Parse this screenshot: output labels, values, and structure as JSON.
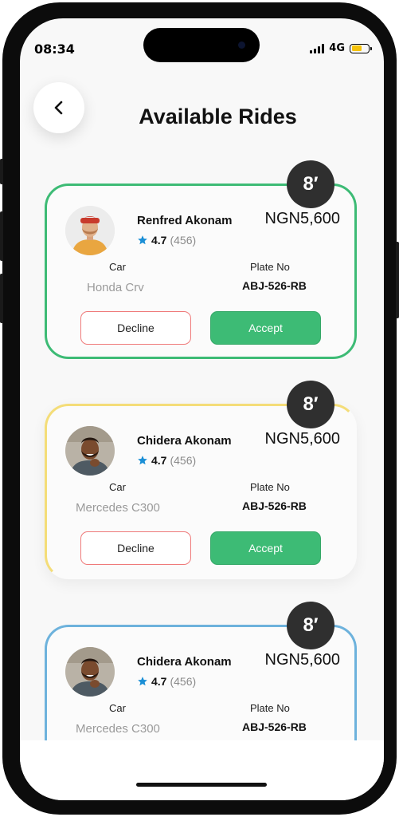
{
  "status_bar": {
    "time": "08:34",
    "network": "4G"
  },
  "header": {
    "back_icon": "chevron-left-icon",
    "title": "Available Rides"
  },
  "rides": [
    {
      "eta": "8′",
      "name": "Renfred Akonam",
      "rating": "4.7",
      "rating_count": "(456)",
      "price": "NGN5,600",
      "car_label": "Car",
      "car": "Honda Crv",
      "plate_label": "Plate No",
      "plate": "ABJ-526-RB",
      "decline_label": "Decline",
      "accept_label": "Accept"
    },
    {
      "eta": "8′",
      "name": "Chidera Akonam",
      "rating": "4.7",
      "rating_count": "(456)",
      "price": "NGN5,600",
      "car_label": "Car",
      "car": "Mercedes C300",
      "plate_label": "Plate No",
      "plate": "ABJ-526-RB",
      "decline_label": "Decline",
      "accept_label": "Accept"
    },
    {
      "eta": "8′",
      "name": "Chidera Akonam",
      "rating": "4.7",
      "rating_count": "(456)",
      "price": "NGN5,600",
      "car_label": "Car",
      "car": "Mercedes C300",
      "plate_label": "Plate No",
      "plate": "ABJ-526-RB"
    }
  ],
  "colors": {
    "accent_green": "#3dbb75",
    "decline_border": "#ef7a7a",
    "card_yellow": "#f4dd78",
    "card_blue": "#6db2dc",
    "star": "#1b8fd6"
  }
}
